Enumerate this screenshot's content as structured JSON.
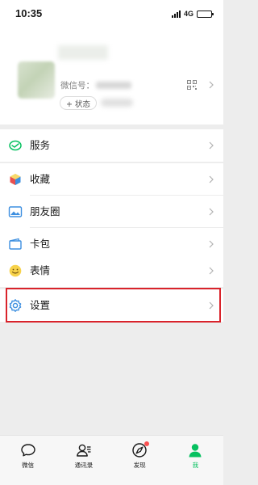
{
  "status_bar": {
    "time": "10:35",
    "network": "4G"
  },
  "profile": {
    "wechat_id_label": "微信号：",
    "status_button": "+ 状态"
  },
  "menu": {
    "services": "服务",
    "favorites": "收藏",
    "moments": "朋友圈",
    "cards": "卡包",
    "stickers": "表情",
    "settings": "设置"
  },
  "tabbar": {
    "tabs": [
      {
        "label": "微信",
        "icon": "chat-bubble-icon",
        "active": false
      },
      {
        "label": "通讯录",
        "icon": "contacts-icon",
        "active": false
      },
      {
        "label": "发现",
        "icon": "compass-icon",
        "active": false,
        "badge": "red-dot"
      },
      {
        "label": "我",
        "icon": "person-icon",
        "active": true
      }
    ]
  },
  "colors": {
    "accent": "#07c160",
    "highlight": "#d9232b",
    "badge": "#fa5151",
    "background": "#ededed"
  }
}
